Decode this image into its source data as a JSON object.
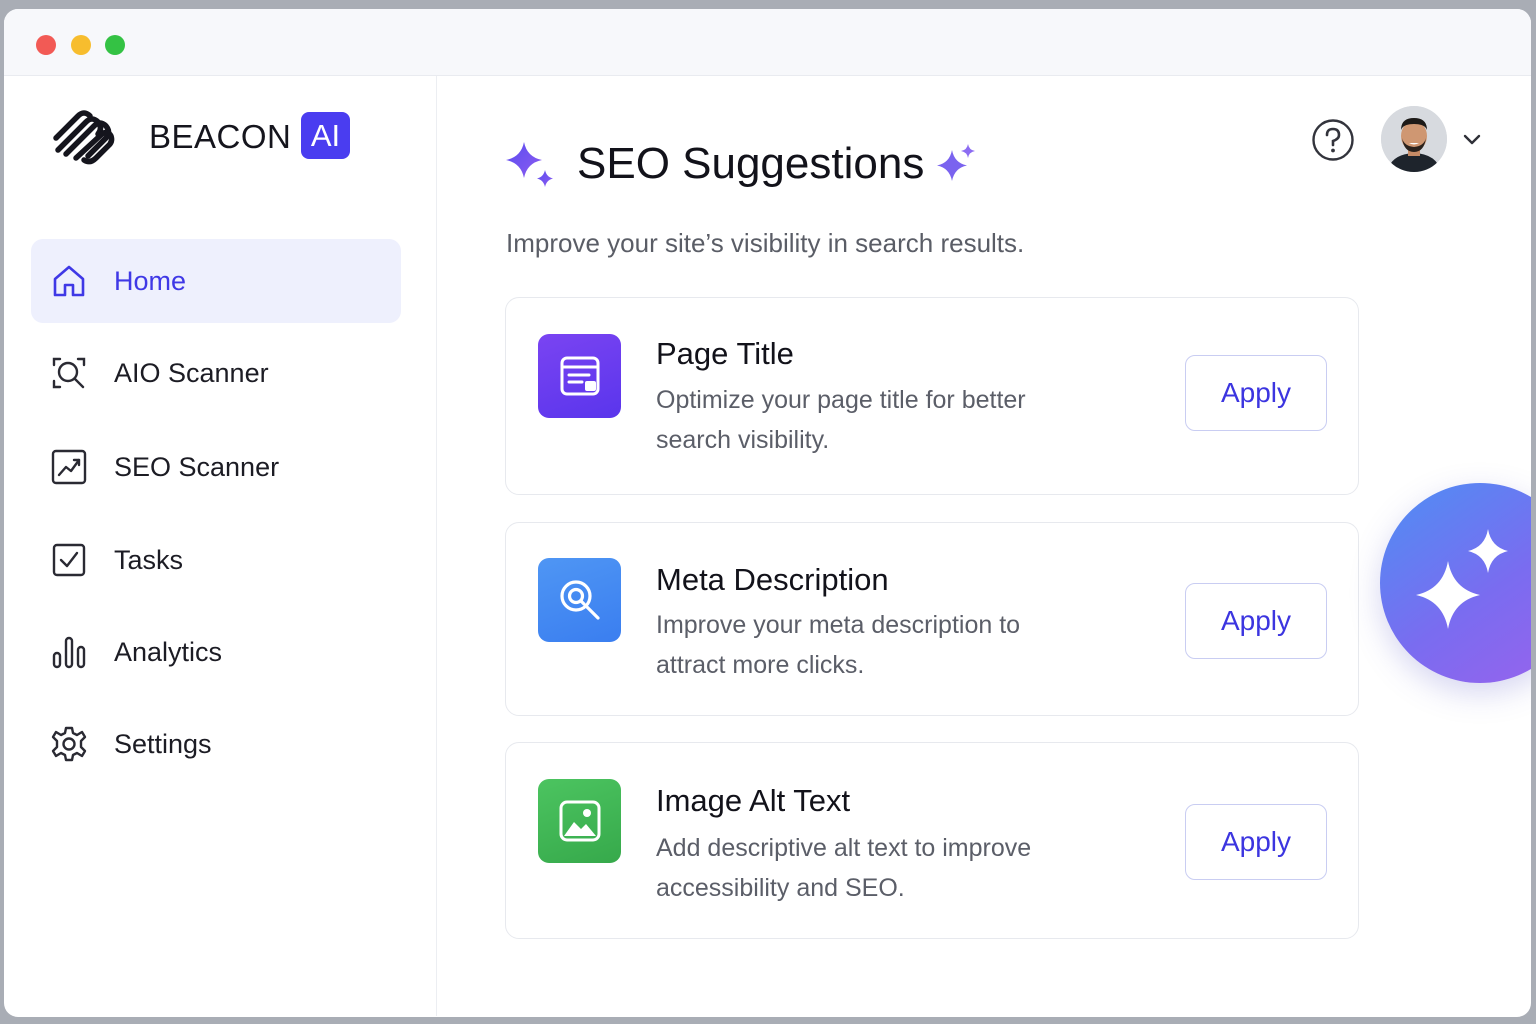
{
  "window": {
    "controls": [
      "close",
      "minimize",
      "maximize"
    ]
  },
  "brand": {
    "name": "BEACON",
    "badge": "AI",
    "logo_icon": "striped-swirl-logo",
    "accent_color": "#4a3df0"
  },
  "sidebar": {
    "items": [
      {
        "label": "Home",
        "icon": "home-icon",
        "active": true
      },
      {
        "label": "AIO Scanner",
        "icon": "scan-search-icon",
        "active": false
      },
      {
        "label": "SEO Scanner",
        "icon": "chart-trend-icon",
        "active": false
      },
      {
        "label": "Tasks",
        "icon": "checkbox-icon",
        "active": false
      },
      {
        "label": "Analytics",
        "icon": "bar-chart-icon",
        "active": false
      },
      {
        "label": "Settings",
        "icon": "gear-icon",
        "active": false
      }
    ]
  },
  "header": {
    "title": "SEO Suggestions",
    "subtitle": "Improve your site’s visibility in search results.",
    "help_icon": "question-circle-icon",
    "avatar_icon": "user-avatar",
    "menu_icon": "chevron-down-icon"
  },
  "suggestions": [
    {
      "title": "Page Title",
      "description": "Optimize your page title for better search visibility.",
      "action": "Apply",
      "icon": "page-layout-icon",
      "color": "#6b3cf0"
    },
    {
      "title": "Meta Description",
      "description": "Improve your meta description to attract more clicks.",
      "action": "Apply",
      "icon": "search-magnifier-icon",
      "color": "#3d86f0"
    },
    {
      "title": "Image Alt Text",
      "description": "Add descriptive alt text to improve accessibility and SEO.",
      "action": "Apply",
      "icon": "image-icon",
      "color": "#3fb552"
    }
  ],
  "assistant": {
    "icon": "sparkle-icon"
  }
}
